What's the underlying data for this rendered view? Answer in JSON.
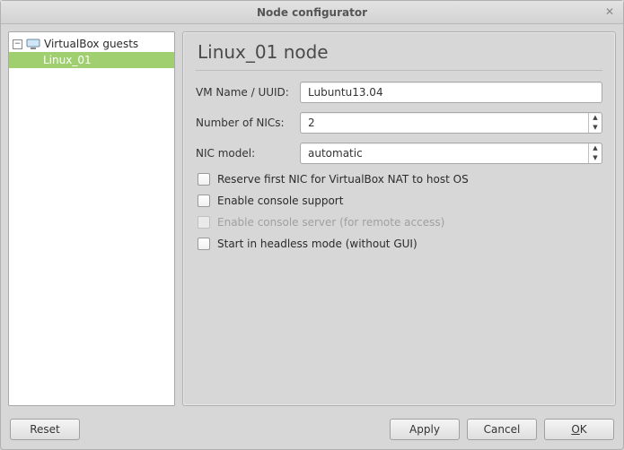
{
  "window": {
    "title": "Node configurator"
  },
  "tree": {
    "root_label": "VirtualBox guests",
    "selected_label": "Linux_01"
  },
  "panel": {
    "title": "Linux_01 node",
    "vm_name_label": "VM Name / UUID:",
    "vm_name_value": "Lubuntu13.04",
    "nics_label": "Number of NICs:",
    "nics_value": "2",
    "nic_model_label": "NIC model:",
    "nic_model_value": "automatic",
    "checkboxes": {
      "reserve_nat": "Reserve first NIC for VirtualBox NAT to host OS",
      "console_support": "Enable console support",
      "console_server": "Enable console server (for remote access)",
      "headless": "Start in headless mode (without GUI)"
    }
  },
  "buttons": {
    "reset": "Reset",
    "apply": "Apply",
    "cancel": "Cancel",
    "ok": "OK"
  }
}
